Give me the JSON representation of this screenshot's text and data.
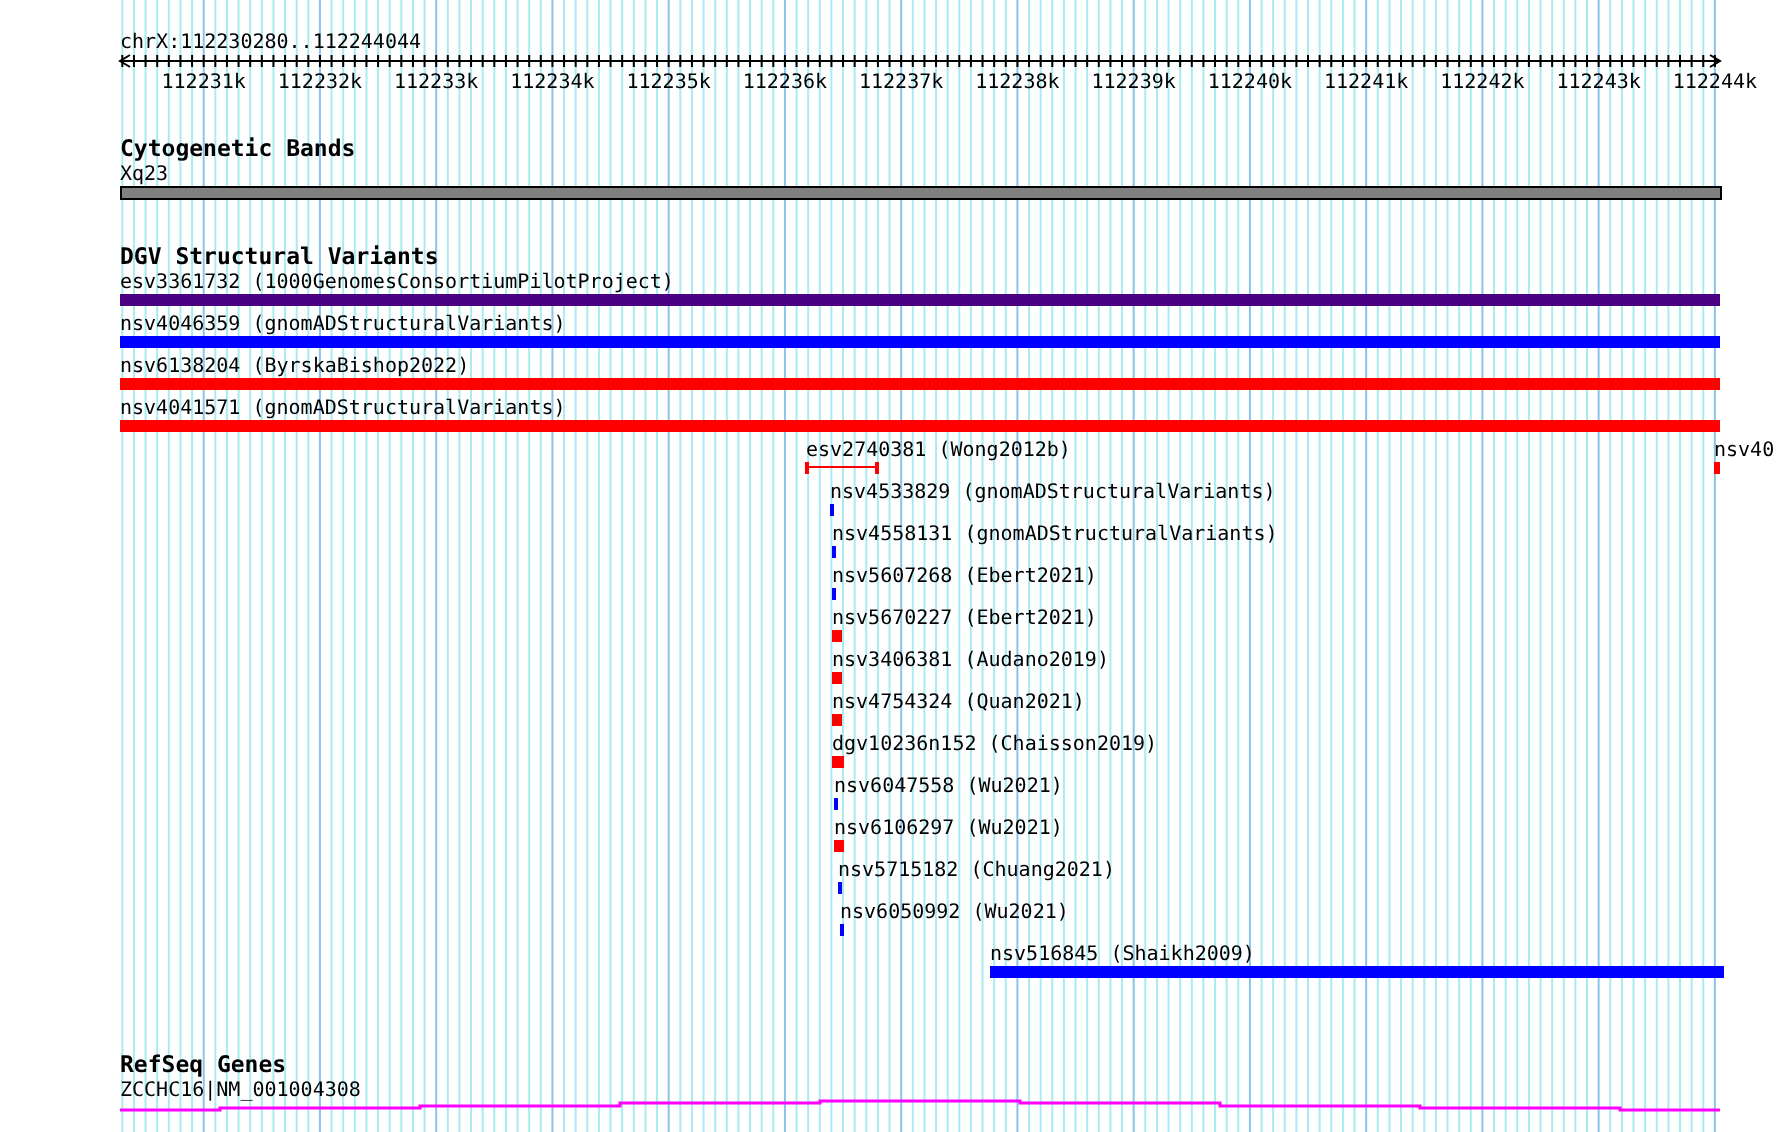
{
  "ruler": {
    "location": "chrX:112230280..112244044",
    "ticks": [
      "112231k",
      "112232k",
      "112233k",
      "112234k",
      "112235k",
      "112236k",
      "112237k",
      "112238k",
      "112239k",
      "112240k",
      "112241k",
      "112242k",
      "112243k",
      "112244k"
    ]
  },
  "tracks": [
    {
      "title": "Cytogenetic Bands",
      "kind": "bands",
      "features": [
        {
          "label": "Xq23",
          "color": "#808080"
        }
      ]
    },
    {
      "title": "DGV Structural Variants",
      "kind": "variants",
      "features": [
        {
          "label": "esv3361732 (1000GenomesConsortiumPilotProject)",
          "kind": "block",
          "color": "#4b0082"
        },
        {
          "label": "nsv4046359 (gnomADStructuralVariants)",
          "kind": "block",
          "color": "#0000ff"
        },
        {
          "label": "nsv6138204 (ByrskaBishop2022)",
          "kind": "block",
          "color": "#ff0000"
        },
        {
          "label": "nsv4041571 (gnomADStructuralVariants)",
          "kind": "block",
          "color": "#ff0000"
        },
        {
          "label": "esv2740381 (Wong2012b)",
          "kind": "interval",
          "color": "#ff0000"
        },
        {
          "label": "nsv40",
          "kind": "block",
          "color": "#ff0000"
        },
        {
          "label": "nsv4533829 (gnomADStructuralVariants)",
          "kind": "block",
          "color": "#0000ff"
        },
        {
          "label": "nsv4558131 (gnomADStructuralVariants)",
          "kind": "block",
          "color": "#0000ff"
        },
        {
          "label": "nsv5607268 (Ebert2021)",
          "kind": "block",
          "color": "#0000ff"
        },
        {
          "label": "nsv5670227 (Ebert2021)",
          "kind": "block",
          "color": "#ff0000"
        },
        {
          "label": "nsv3406381 (Audano2019)",
          "kind": "block",
          "color": "#ff0000"
        },
        {
          "label": "nsv4754324 (Quan2021)",
          "kind": "block",
          "color": "#ff0000"
        },
        {
          "label": "dgv10236n152 (Chaisson2019)",
          "kind": "block",
          "color": "#ff0000"
        },
        {
          "label": "nsv6047558 (Wu2021)",
          "kind": "block",
          "color": "#0000ff"
        },
        {
          "label": "nsv6106297 (Wu2021)",
          "kind": "block",
          "color": "#ff0000"
        },
        {
          "label": "nsv5715182 (Chuang2021)",
          "kind": "block",
          "color": "#0000ff"
        },
        {
          "label": "nsv6050992 (Wu2021)",
          "kind": "block",
          "color": "#0000ff"
        },
        {
          "label": "nsv516845 (Shaikh2009)",
          "kind": "block",
          "color": "#0000ff"
        }
      ]
    },
    {
      "title": "RefSeq Genes",
      "kind": "genes",
      "features": [
        {
          "label": "ZCCHC16|NM_001004308",
          "color": "#ff00ff"
        }
      ]
    }
  ]
}
